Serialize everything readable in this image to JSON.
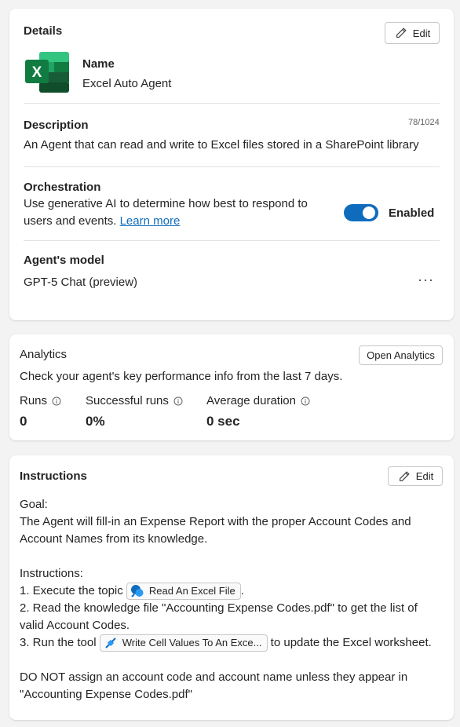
{
  "details": {
    "title": "Details",
    "edit_label": "Edit",
    "name_label": "Name",
    "name_value": "Excel Auto Agent",
    "description_label": "Description",
    "description_count": "78/1024",
    "description_value": "An Agent that can read and write to Excel files stored in a SharePoint library",
    "orchestration_label": "Orchestration",
    "orchestration_text_line1": "Use generative AI to determine how best to respond to",
    "orchestration_text_line2": "users and events.",
    "learn_more": "Learn more",
    "toggle_state": "Enabled",
    "model_label": "Agent's model",
    "model_value": "GPT-5 Chat (preview)",
    "more_label": "···",
    "excel_letter": "X"
  },
  "analytics": {
    "title": "Analytics",
    "open_label": "Open Analytics",
    "subtitle": "Check your agent's key performance info from the last 7 days.",
    "metrics": [
      {
        "label": "Runs",
        "value": "0"
      },
      {
        "label": "Successful runs",
        "value": "0%"
      },
      {
        "label": "Average duration",
        "value": "0 sec"
      }
    ]
  },
  "instructions": {
    "title": "Instructions",
    "edit_label": "Edit",
    "goal_label": "Goal:",
    "goal_line1": "The Agent will fill-in an Expense Report with the proper Account Codes and",
    "goal_line2": "Account Names from its knowledge.",
    "instructions_label": "Instructions:",
    "step1_prefix": "1. Execute the topic",
    "step1_chip": "Read An Excel File",
    "step1_suffix": ".",
    "step2_line1": "2. Read the knowledge file \"Accounting Expense Codes.pdf\" to get the list of",
    "step2_line2": "valid Account Codes.",
    "step3_prefix": "3. Run the tool",
    "step3_chip": "Write Cell Values To An Exce...",
    "step3_suffix": "to update the Excel worksheet.",
    "warn_line1": "DO NOT assign an account code and account name unless they appear in",
    "warn_line2": "\"Accounting Expense Codes.pdf\""
  },
  "colors": {
    "accent": "#0f6cbd",
    "excel_green": "#107c41"
  }
}
